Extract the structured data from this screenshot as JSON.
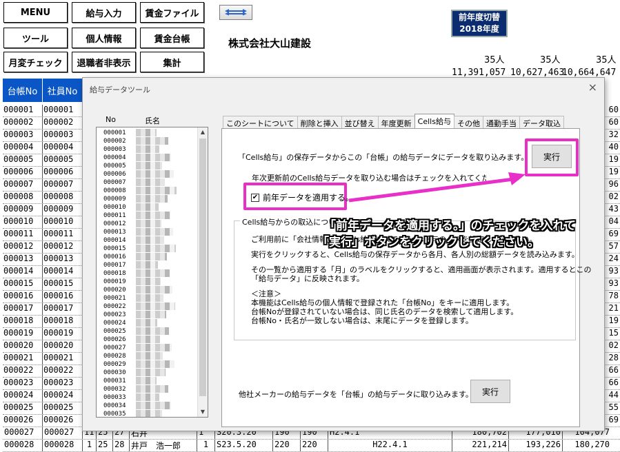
{
  "macro_buttons": [
    {
      "id": "menu",
      "label": "MENU"
    },
    {
      "id": "salary-input",
      "label": "給与入力"
    },
    {
      "id": "wage-file",
      "label": "賃金ファイル"
    },
    {
      "id": "tools",
      "label": "ツール"
    },
    {
      "id": "personal-info",
      "label": "個人情報"
    },
    {
      "id": "wage-ledger",
      "label": "賃金台帳"
    },
    {
      "id": "monthly-check",
      "label": "月変チェック"
    },
    {
      "id": "hide-retired",
      "label": "退職者非表示"
    },
    {
      "id": "totals",
      "label": "集計"
    }
  ],
  "swap_icon": "left-right-arrow",
  "year_badge": {
    "line1": "前年度切替",
    "line2": "2018年度"
  },
  "company_name": "株式会社大山建設",
  "header_counts": [
    "35人",
    "35人",
    "35人"
  ],
  "header_totals": [
    "11,391,057",
    "10,627,463",
    "10,664,647"
  ],
  "sheet": {
    "col1_header": "台帳No",
    "col2_header": "社員No",
    "rows": [
      "000001",
      "000002",
      "000003",
      "000004",
      "000005",
      "000006",
      "000007",
      "000008",
      "000009",
      "000010",
      "000011",
      "000012",
      "000013",
      "000014",
      "000015",
      "000016",
      "000017",
      "000018",
      "000019",
      "000020",
      "000021",
      "000022",
      "000023",
      "000024",
      "000025",
      "000026"
    ],
    "right_values": [
      "60",
      "60",
      "32",
      "40",
      "19",
      "19",
      "96",
      "02",
      "43",
      "04",
      "69",
      "57",
      "24",
      "93",
      "93",
      "78",
      "21",
      "19",
      "15",
      "02",
      "28",
      "66",
      "66",
      "44",
      "55",
      "69"
    ],
    "row27": {
      "ledger": "000027",
      "emp": "000027",
      "a": "11",
      "b": "25",
      "c": "27",
      "name": "石井",
      "d": "1",
      "date": "S20.3.20",
      "e": "190",
      "f": "190",
      "g": "H2.4.1",
      "v1": "180,702",
      "v2": "177,010",
      "v3": "104,077"
    },
    "row28": {
      "ledger": "000028",
      "emp": "000028",
      "a": "1",
      "b": "25",
      "c": "28",
      "name": "井戸　浩一郎",
      "d": "1",
      "date": "S23.5.20",
      "e": "220",
      "f": "220",
      "g": "H22.4.1",
      "v1": "221,214",
      "v2": "193,226",
      "v3": "180,270"
    }
  },
  "dialog": {
    "title": "給与データツール",
    "close": "×",
    "list_header_no": "No",
    "list_header_name": "氏名",
    "list_numbers": [
      "000001",
      "000002",
      "000003",
      "000004",
      "000005",
      "000006",
      "000007",
      "000008",
      "000009",
      "000010",
      "000011",
      "000012",
      "000013",
      "000014",
      "000015",
      "000016",
      "000017",
      "000018",
      "000019",
      "000020",
      "000021",
      "000022",
      "000023",
      "000024",
      "000025",
      "000026",
      "000027",
      "000028",
      "000029",
      "000030",
      "000031",
      "000032",
      "000033",
      "000034",
      "000035"
    ],
    "tabs": [
      "このシートについて",
      "削除と挿入",
      "並び替え",
      "年度更新",
      "Cells給与",
      "その他",
      "通勤手当",
      "データ取込"
    ],
    "active_tab": 4,
    "panel": {
      "intro": "「Cells給与」の保存データからこの「台帳」の給与データにデータを取り込みます。",
      "execute_label": "実行",
      "note": "年次更新前のCells給与データを取り込む場合はチェックを入れてください。",
      "checkbox_label": "前年データを適用する。",
      "checkbox_checked": "✔",
      "group_title": "Cells給与からの取込について",
      "group_lines": [
        "ご利用前に「会社情報」のCells給与パスで、Cells給与のパスを設定してください。",
        "実行をクリックすると、Cells給与の保存データから各月、各人別の総額データを読み込みます。",
        "その一覧から適用する「月」のラベルをクリックすると、適用画面が表示されます。適用するとこの",
        "「給与データ」に反映されます。",
        "＜注意＞",
        "本機能はCells給与の個人情報で登録された「台帳No」をキーに適用します。",
        "台帳Noが登録されていない場合は、同じ氏名のデータを検索して適用します。",
        "台帳No・氏名が一致しない場合は、末尾にデータを登録します。"
      ],
      "other_text": "他社メーカーの給与データを「台帳」の給与データに取り込みます。",
      "other_execute_label": "実行"
    }
  },
  "callout": {
    "line1": "「前年データを適用する。」のチェックを入れて",
    "line2": "「実行」ボタンをクリックしてください。"
  },
  "colors": {
    "header_blue": "#0a56c6",
    "highlight": "#e830c8",
    "badge": "#0b2c6f"
  }
}
